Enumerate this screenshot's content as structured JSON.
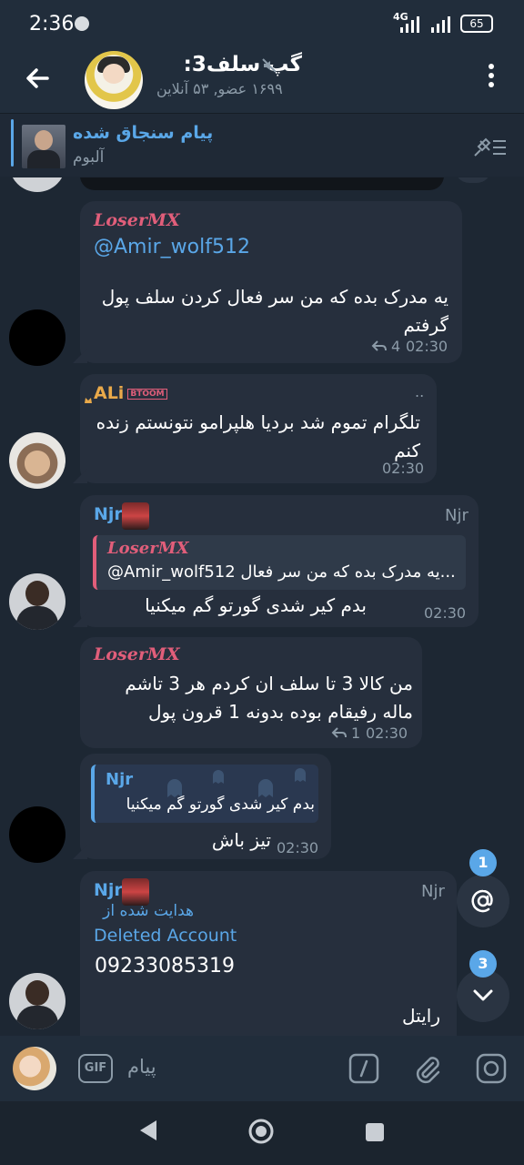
{
  "status_bar": {
    "time": "2:36",
    "network": "4G",
    "battery": "65"
  },
  "header": {
    "title": "گپ سلف3:",
    "subtitle": "۱۶۹۹ عضو, ۵۳ آنلاین"
  },
  "pinned": {
    "title": "پیام سنجاق شده",
    "subtitle": "آلبوم"
  },
  "messages": [
    {
      "sender": "LoserMX",
      "mention": "@Amir_wolf512",
      "text": "یه مدرک بده که من سر فعال کردن سلف پول گرفتم",
      "replies": "4",
      "time": "02:30"
    },
    {
      "sender": "ALi",
      "badge": "BTOOM",
      "dots": "..",
      "text": "تلگرام تموم شد بردیا هلپرامو نتونستم زنده کنم",
      "time": "02:30"
    },
    {
      "sender": "Njr",
      "tag": "Njr",
      "reply_to_sender": "LoserMX",
      "reply_to_text": "@Amir_wolf512  یه مدرک بده که من سر فعال...",
      "text": "بدم کیر شدی گورتو گم میکنیا",
      "time": "02:30"
    },
    {
      "sender": "LoserMX",
      "text": "من کالا 3 تا سلف ان کردم هر 3 تاشم ماله رفیقام بوده بدونه 1 قرون پول",
      "replies": "1",
      "time": "02:30"
    },
    {
      "reply_to_sender": "Njr",
      "reply_to_text": "بدم کیر شدی گورتو گم میکنیا",
      "text": "تیز باش",
      "time": "02:30"
    },
    {
      "sender": "Njr",
      "tag": "Njr",
      "forwarded_label": "هدایت شده از",
      "forwarded_from": "Deleted Account",
      "phone": "09233085319",
      "text": "رایتل"
    }
  ],
  "fabs": {
    "mentions_count": "1",
    "unread_count": "3"
  },
  "input": {
    "placeholder": "پیام",
    "gif_label": "GIF"
  },
  "colors": {
    "accent": "#5aa7e8",
    "bg": "#1d2733",
    "bubble": "#262f3d",
    "loser_name": "#e15e7a",
    "ali_name": "#e9a94a"
  }
}
